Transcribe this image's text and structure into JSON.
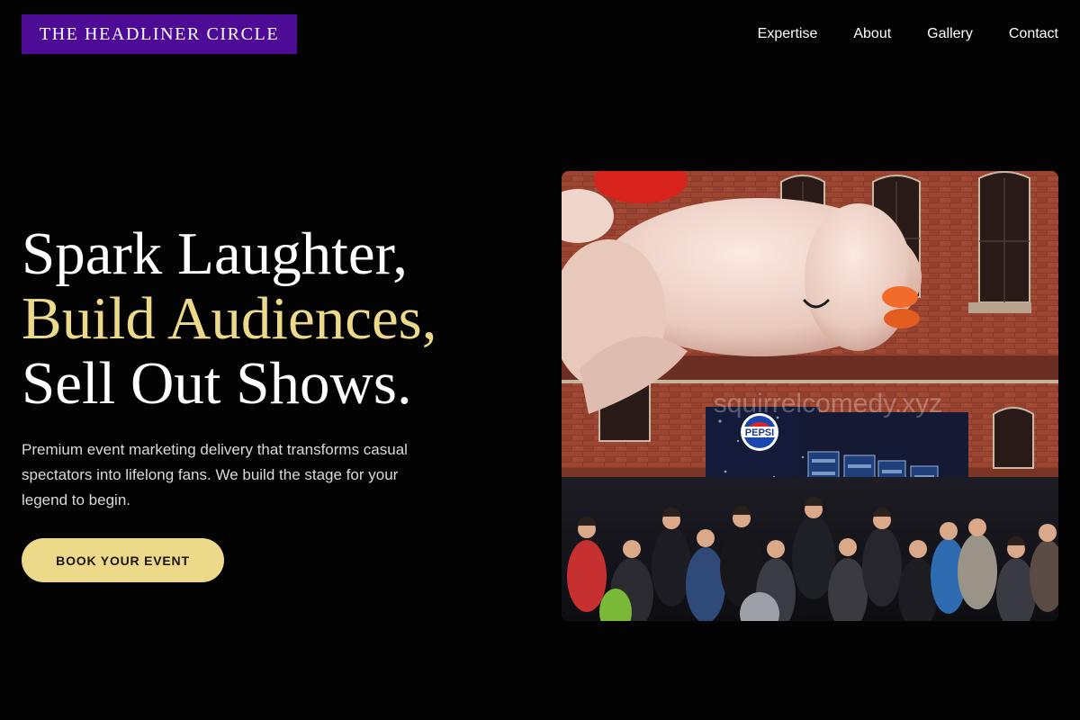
{
  "header": {
    "logo_text": "THE HEADLINER CIRCLE",
    "nav": [
      "Expertise",
      "About",
      "Gallery",
      "Contact"
    ]
  },
  "hero": {
    "headline_line1": "Spark Laughter,",
    "headline_line2": "Build Audiences,",
    "headline_line3": "Sell Out Shows.",
    "description": "Premium event marketing delivery that transforms casual spectators into lifelong fans. We build the stage for your legend to begin.",
    "cta_label": "BOOK YOUR EVENT"
  },
  "photo": {
    "brand_sign": "PEPSI",
    "watermark": "squirrelcomedy.xyz"
  },
  "colors": {
    "background": "#030303",
    "logo_bg": "#4e0c96",
    "accent": "#ecd98a",
    "text": "#ffffff",
    "muted_text": "#d9d9de"
  }
}
